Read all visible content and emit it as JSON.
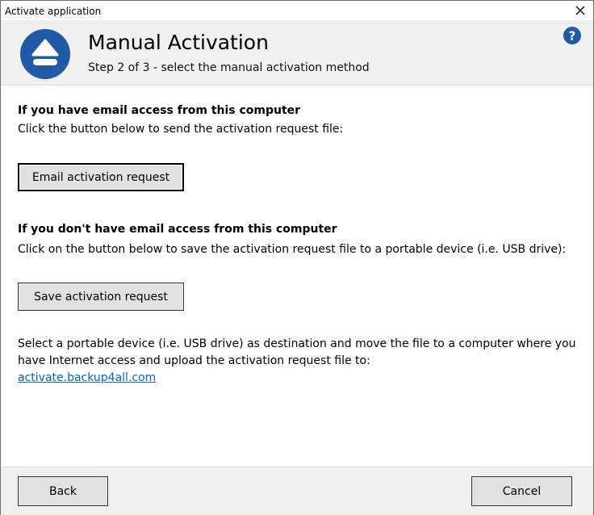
{
  "window": {
    "title": "Activate application"
  },
  "header": {
    "title": "Manual Activation",
    "subtitle": "Step 2 of 3 - select the manual activation method",
    "logo_icon": "upload-eject-icon",
    "help_icon": "help-icon",
    "accent_color": "#1f5aa6"
  },
  "email_section": {
    "heading": "If you have email access from this computer",
    "instruction": "Click the button below to send the activation request file:",
    "button_label": "Email activation request"
  },
  "save_section": {
    "heading": "If you don't have email access from this computer",
    "instruction": "Click on the button below to save the activation request file to a portable device (i.e. USB drive):",
    "button_label": "Save activation request"
  },
  "instructions": {
    "line1": "Select a portable device (i.e. USB drive) as destination and move the file to a computer where you",
    "line2": "have Internet access and upload the activation request file to:",
    "link": "activate.backup4all.com"
  },
  "footer": {
    "back_label": "Back",
    "cancel_label": "Cancel"
  }
}
